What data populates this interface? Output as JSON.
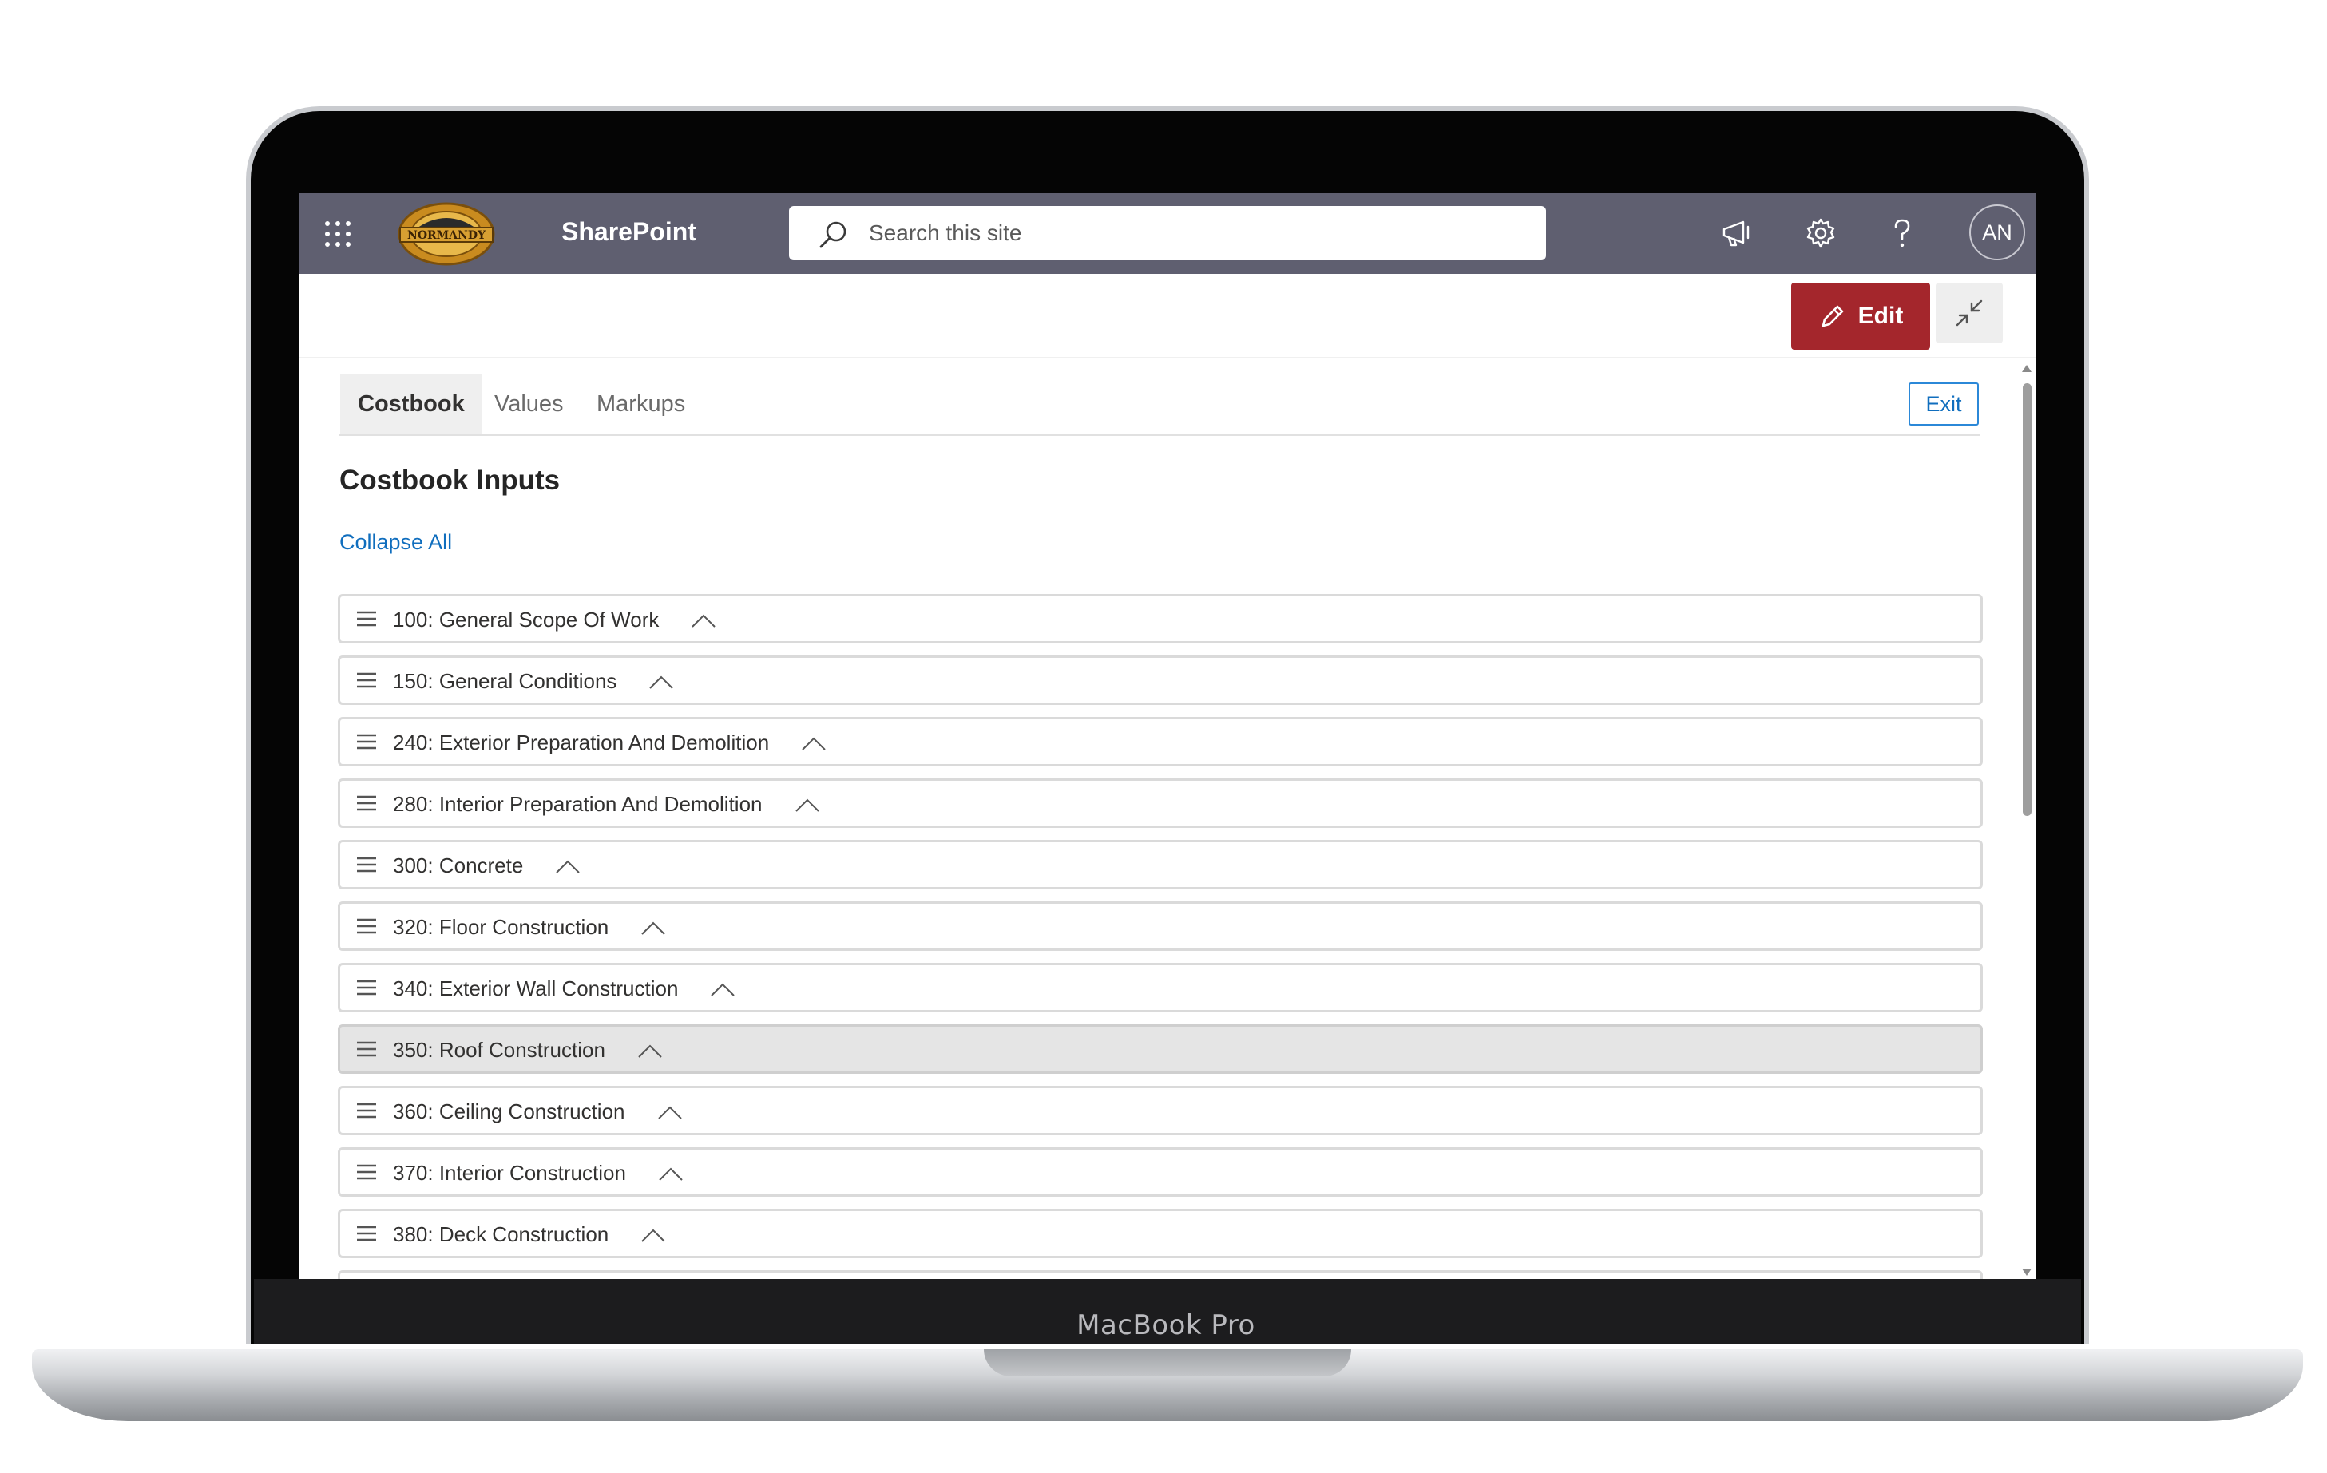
{
  "device": {
    "model_label": "MacBook Pro"
  },
  "suite_bar": {
    "app_name": "SharePoint",
    "logo_text": "NORMANDY",
    "search_placeholder": "Search this site",
    "avatar_initials": "AN"
  },
  "command_bar": {
    "edit_label": "Edit"
  },
  "tabs": [
    {
      "label": "Costbook",
      "active": true
    },
    {
      "label": "Values",
      "active": false
    },
    {
      "label": "Markups",
      "active": false
    }
  ],
  "exit_label": "Exit",
  "section_title": "Costbook Inputs",
  "collapse_all_label": "Collapse All",
  "costbook_items": [
    {
      "label": "100: General Scope Of Work"
    },
    {
      "label": "150: General Conditions"
    },
    {
      "label": "240: Exterior Preparation And Demolition"
    },
    {
      "label": "280: Interior Preparation And Demolition"
    },
    {
      "label": "300: Concrete"
    },
    {
      "label": "320: Floor Construction"
    },
    {
      "label": "340: Exterior Wall Construction"
    },
    {
      "label": "350: Roof Construction",
      "selected": true
    },
    {
      "label": "360: Ceiling Construction"
    },
    {
      "label": "370: Interior Construction"
    },
    {
      "label": "380: Deck Construction"
    },
    {
      "label": ""
    }
  ],
  "colors": {
    "suite_bar": "#5f5f70",
    "edit_button": "#a4262c",
    "link": "#106ebe"
  }
}
